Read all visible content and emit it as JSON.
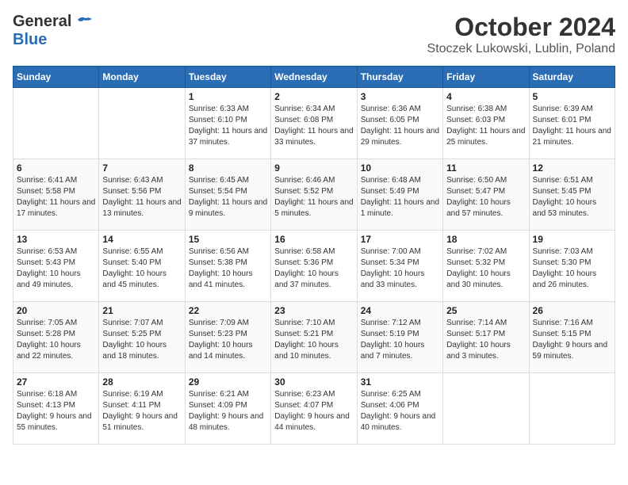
{
  "header": {
    "logo_general": "General",
    "logo_blue": "Blue",
    "month_year": "October 2024",
    "location": "Stoczek Lukowski, Lublin, Poland"
  },
  "weekdays": [
    "Sunday",
    "Monday",
    "Tuesday",
    "Wednesday",
    "Thursday",
    "Friday",
    "Saturday"
  ],
  "weeks": [
    [
      {
        "day": "",
        "info": ""
      },
      {
        "day": "",
        "info": ""
      },
      {
        "day": "1",
        "info": "Sunrise: 6:33 AM\nSunset: 6:10 PM\nDaylight: 11 hours and 37 minutes."
      },
      {
        "day": "2",
        "info": "Sunrise: 6:34 AM\nSunset: 6:08 PM\nDaylight: 11 hours and 33 minutes."
      },
      {
        "day": "3",
        "info": "Sunrise: 6:36 AM\nSunset: 6:05 PM\nDaylight: 11 hours and 29 minutes."
      },
      {
        "day": "4",
        "info": "Sunrise: 6:38 AM\nSunset: 6:03 PM\nDaylight: 11 hours and 25 minutes."
      },
      {
        "day": "5",
        "info": "Sunrise: 6:39 AM\nSunset: 6:01 PM\nDaylight: 11 hours and 21 minutes."
      }
    ],
    [
      {
        "day": "6",
        "info": "Sunrise: 6:41 AM\nSunset: 5:58 PM\nDaylight: 11 hours and 17 minutes."
      },
      {
        "day": "7",
        "info": "Sunrise: 6:43 AM\nSunset: 5:56 PM\nDaylight: 11 hours and 13 minutes."
      },
      {
        "day": "8",
        "info": "Sunrise: 6:45 AM\nSunset: 5:54 PM\nDaylight: 11 hours and 9 minutes."
      },
      {
        "day": "9",
        "info": "Sunrise: 6:46 AM\nSunset: 5:52 PM\nDaylight: 11 hours and 5 minutes."
      },
      {
        "day": "10",
        "info": "Sunrise: 6:48 AM\nSunset: 5:49 PM\nDaylight: 11 hours and 1 minute."
      },
      {
        "day": "11",
        "info": "Sunrise: 6:50 AM\nSunset: 5:47 PM\nDaylight: 10 hours and 57 minutes."
      },
      {
        "day": "12",
        "info": "Sunrise: 6:51 AM\nSunset: 5:45 PM\nDaylight: 10 hours and 53 minutes."
      }
    ],
    [
      {
        "day": "13",
        "info": "Sunrise: 6:53 AM\nSunset: 5:43 PM\nDaylight: 10 hours and 49 minutes."
      },
      {
        "day": "14",
        "info": "Sunrise: 6:55 AM\nSunset: 5:40 PM\nDaylight: 10 hours and 45 minutes."
      },
      {
        "day": "15",
        "info": "Sunrise: 6:56 AM\nSunset: 5:38 PM\nDaylight: 10 hours and 41 minutes."
      },
      {
        "day": "16",
        "info": "Sunrise: 6:58 AM\nSunset: 5:36 PM\nDaylight: 10 hours and 37 minutes."
      },
      {
        "day": "17",
        "info": "Sunrise: 7:00 AM\nSunset: 5:34 PM\nDaylight: 10 hours and 33 minutes."
      },
      {
        "day": "18",
        "info": "Sunrise: 7:02 AM\nSunset: 5:32 PM\nDaylight: 10 hours and 30 minutes."
      },
      {
        "day": "19",
        "info": "Sunrise: 7:03 AM\nSunset: 5:30 PM\nDaylight: 10 hours and 26 minutes."
      }
    ],
    [
      {
        "day": "20",
        "info": "Sunrise: 7:05 AM\nSunset: 5:28 PM\nDaylight: 10 hours and 22 minutes."
      },
      {
        "day": "21",
        "info": "Sunrise: 7:07 AM\nSunset: 5:25 PM\nDaylight: 10 hours and 18 minutes."
      },
      {
        "day": "22",
        "info": "Sunrise: 7:09 AM\nSunset: 5:23 PM\nDaylight: 10 hours and 14 minutes."
      },
      {
        "day": "23",
        "info": "Sunrise: 7:10 AM\nSunset: 5:21 PM\nDaylight: 10 hours and 10 minutes."
      },
      {
        "day": "24",
        "info": "Sunrise: 7:12 AM\nSunset: 5:19 PM\nDaylight: 10 hours and 7 minutes."
      },
      {
        "day": "25",
        "info": "Sunrise: 7:14 AM\nSunset: 5:17 PM\nDaylight: 10 hours and 3 minutes."
      },
      {
        "day": "26",
        "info": "Sunrise: 7:16 AM\nSunset: 5:15 PM\nDaylight: 9 hours and 59 minutes."
      }
    ],
    [
      {
        "day": "27",
        "info": "Sunrise: 6:18 AM\nSunset: 4:13 PM\nDaylight: 9 hours and 55 minutes."
      },
      {
        "day": "28",
        "info": "Sunrise: 6:19 AM\nSunset: 4:11 PM\nDaylight: 9 hours and 51 minutes."
      },
      {
        "day": "29",
        "info": "Sunrise: 6:21 AM\nSunset: 4:09 PM\nDaylight: 9 hours and 48 minutes."
      },
      {
        "day": "30",
        "info": "Sunrise: 6:23 AM\nSunset: 4:07 PM\nDaylight: 9 hours and 44 minutes."
      },
      {
        "day": "31",
        "info": "Sunrise: 6:25 AM\nSunset: 4:06 PM\nDaylight: 9 hours and 40 minutes."
      },
      {
        "day": "",
        "info": ""
      },
      {
        "day": "",
        "info": ""
      }
    ]
  ]
}
